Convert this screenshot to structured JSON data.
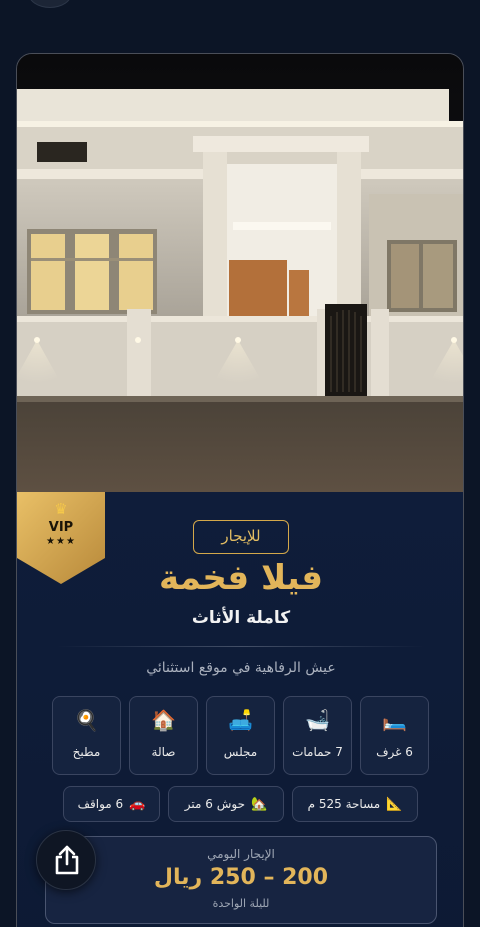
{
  "listing": {
    "badge_vip": "VIP",
    "badge_stars": "★★★",
    "badge_icon": "crown-icon",
    "for_rent_label": "للإيجار",
    "title": "فيلا فخمة",
    "subtitle": "كاملة الأثاث",
    "tagline": "عيش الرفاهية في موقع استثنائي"
  },
  "features": [
    {
      "label": "6 غرف",
      "icon": "bed-icon",
      "glyph": "🛏️"
    },
    {
      "label": "7 حمامات",
      "icon": "bathtub-icon",
      "glyph": "🛁"
    },
    {
      "label": "مجلس",
      "icon": "sofa-icon",
      "glyph": "🛋️"
    },
    {
      "label": "صالة",
      "icon": "house-icon",
      "glyph": "🏠"
    },
    {
      "label": "مطبخ",
      "icon": "frying-pan-icon",
      "glyph": "🍳"
    }
  ],
  "details": [
    {
      "label": "مساحة 525 م",
      "icon": "ruler-icon",
      "glyph": "📐"
    },
    {
      "label": "حوش 6 متر",
      "icon": "yard-icon",
      "glyph": "🏡"
    },
    {
      "label": "6 مواقف",
      "icon": "car-icon",
      "glyph": "🚗"
    }
  ],
  "price": {
    "label": "الإيجار اليومي",
    "value": "200 – 250 ريال",
    "note": "لليلة الواحدة"
  },
  "colors": {
    "background": "#0c1526",
    "panel": "#0f1d3a",
    "gold": "#e2b55a"
  }
}
